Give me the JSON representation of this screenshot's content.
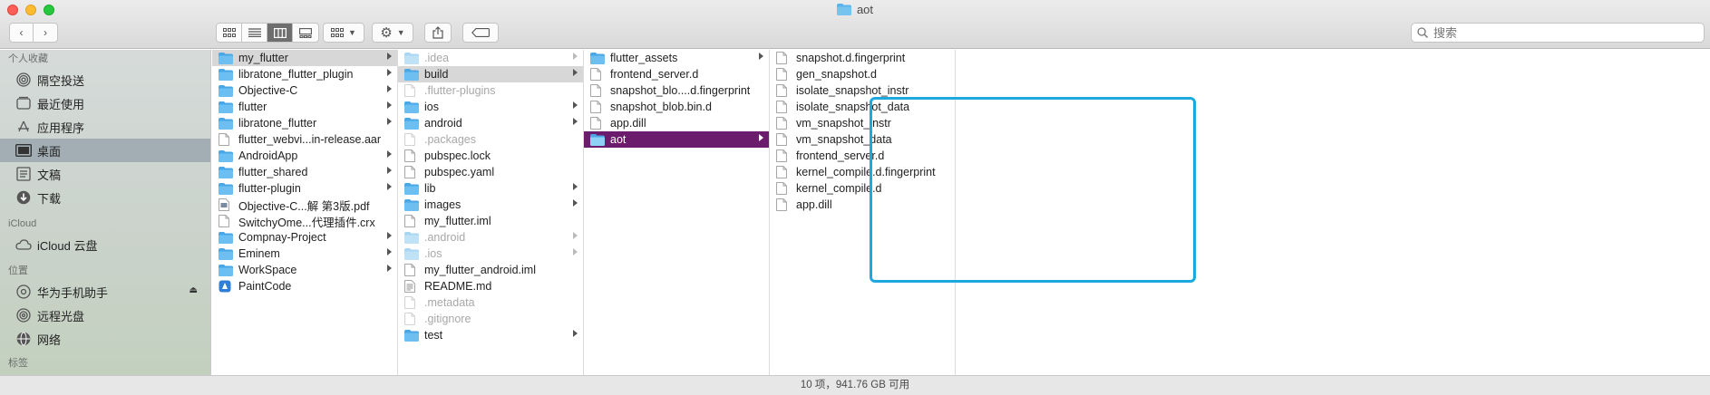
{
  "window": {
    "title": "aot"
  },
  "toolbar": {
    "back_icon": "chevron-left-icon",
    "forward_icon": "chevron-right-icon",
    "views": [
      "icon-view",
      "list-view",
      "column-view",
      "gallery-view"
    ],
    "active_view": "column-view",
    "search": {
      "placeholder": "搜索",
      "value": ""
    }
  },
  "sidebar": {
    "sections": [
      {
        "heading": "个人收藏",
        "items": [
          {
            "label": "隔空投送",
            "icon": "airdrop-icon"
          },
          {
            "label": "最近使用",
            "icon": "recents-icon"
          },
          {
            "label": "应用程序",
            "icon": "applications-icon"
          },
          {
            "label": "桌面",
            "icon": "desktop-icon",
            "selected": true
          },
          {
            "label": "文稿",
            "icon": "documents-icon"
          },
          {
            "label": "下载",
            "icon": "downloads-icon"
          }
        ]
      },
      {
        "heading": "iCloud",
        "items": [
          {
            "label": "iCloud 云盘",
            "icon": "cloud-icon"
          }
        ]
      },
      {
        "heading": "位置",
        "items": [
          {
            "label": "华为手机助手",
            "icon": "disk-icon",
            "eject": true
          },
          {
            "label": "远程光盘",
            "icon": "disc-icon"
          },
          {
            "label": "网络",
            "icon": "network-icon"
          }
        ]
      },
      {
        "heading": "标签",
        "items": []
      }
    ]
  },
  "columns": [
    {
      "items": [
        {
          "name": "my_flutter",
          "type": "folder",
          "arrow": true,
          "state": "hl"
        },
        {
          "name": "libratone_flutter_plugin",
          "type": "folder",
          "arrow": true
        },
        {
          "name": "Objective-C",
          "type": "folder",
          "arrow": true
        },
        {
          "name": "flutter",
          "type": "folder",
          "arrow": true
        },
        {
          "name": "libratone_flutter",
          "type": "folder",
          "arrow": true
        },
        {
          "name": "flutter_webvi...in-release.aar",
          "type": "file"
        },
        {
          "name": "AndroidApp",
          "type": "folder",
          "arrow": true
        },
        {
          "name": "flutter_shared",
          "type": "folder",
          "arrow": true
        },
        {
          "name": "flutter-plugin",
          "type": "folder",
          "arrow": true
        },
        {
          "name": "Objective-C...解 第3版.pdf",
          "type": "pdf"
        },
        {
          "name": "SwitchyOme...代理插件.crx",
          "type": "file"
        },
        {
          "name": "Compnay-Project",
          "type": "folder",
          "arrow": true
        },
        {
          "name": "Eminem",
          "type": "folder",
          "arrow": true
        },
        {
          "name": "WorkSpace",
          "type": "folder",
          "arrow": true
        },
        {
          "name": "PaintCode",
          "type": "app"
        }
      ]
    },
    {
      "items": [
        {
          "name": ".idea",
          "type": "folder",
          "arrow": true,
          "state": "dim"
        },
        {
          "name": "build",
          "type": "folder",
          "arrow": true,
          "state": "hl"
        },
        {
          "name": ".flutter-plugins",
          "type": "file",
          "state": "dim"
        },
        {
          "name": "ios",
          "type": "folder",
          "arrow": true
        },
        {
          "name": "android",
          "type": "folder",
          "arrow": true
        },
        {
          "name": ".packages",
          "type": "file",
          "state": "dim"
        },
        {
          "name": "pubspec.lock",
          "type": "file"
        },
        {
          "name": "pubspec.yaml",
          "type": "file"
        },
        {
          "name": "lib",
          "type": "folder",
          "arrow": true
        },
        {
          "name": "images",
          "type": "folder",
          "arrow": true
        },
        {
          "name": "my_flutter.iml",
          "type": "file"
        },
        {
          "name": ".android",
          "type": "folder",
          "arrow": true,
          "state": "dim"
        },
        {
          "name": ".ios",
          "type": "folder",
          "arrow": true,
          "state": "dim"
        },
        {
          "name": "my_flutter_android.iml",
          "type": "file"
        },
        {
          "name": "README.md",
          "type": "md"
        },
        {
          "name": ".metadata",
          "type": "file",
          "state": "dim"
        },
        {
          "name": ".gitignore",
          "type": "file",
          "state": "dim"
        },
        {
          "name": "test",
          "type": "folder",
          "arrow": true
        }
      ]
    },
    {
      "items": [
        {
          "name": "flutter_assets",
          "type": "folder",
          "arrow": true
        },
        {
          "name": "frontend_server.d",
          "type": "file"
        },
        {
          "name": "snapshot_blo....d.fingerprint",
          "type": "file"
        },
        {
          "name": "snapshot_blob.bin.d",
          "type": "file"
        },
        {
          "name": "app.dill",
          "type": "file"
        },
        {
          "name": "aot",
          "type": "folder",
          "arrow": true,
          "state": "sel"
        }
      ]
    },
    {
      "items": [
        {
          "name": "snapshot.d.fingerprint",
          "type": "file"
        },
        {
          "name": "gen_snapshot.d",
          "type": "file"
        },
        {
          "name": "isolate_snapshot_instr",
          "type": "file"
        },
        {
          "name": "isolate_snapshot_data",
          "type": "file"
        },
        {
          "name": "vm_snapshot_instr",
          "type": "file"
        },
        {
          "name": "vm_snapshot_data",
          "type": "file"
        },
        {
          "name": "frontend_server.d",
          "type": "file"
        },
        {
          "name": "kernel_compile.d.fingerprint",
          "type": "file"
        },
        {
          "name": "kernel_compile.d",
          "type": "file"
        },
        {
          "name": "app.dill",
          "type": "file"
        }
      ]
    },
    {
      "items": []
    }
  ],
  "status": {
    "text": "10 项，941.76 GB 可用"
  },
  "colors": {
    "selection": "#6c1c6c",
    "highlight_box": "#1ea8e0",
    "folder": "#5ab3ea"
  }
}
